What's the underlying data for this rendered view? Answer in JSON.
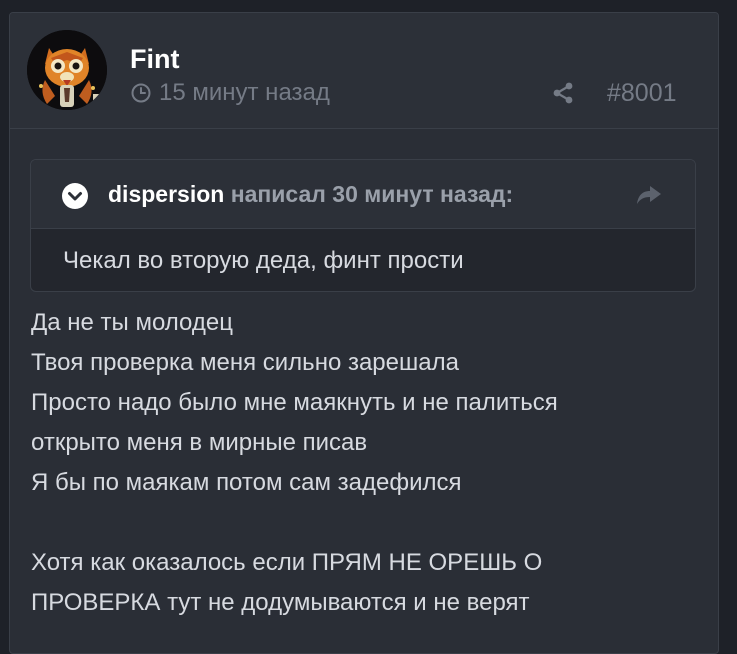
{
  "post": {
    "author": "Fint",
    "time": "15 минут назад",
    "number": "#8001",
    "quote": {
      "author": "dispersion",
      "action": "написал 30 минут назад:",
      "text": "Чекал во вторую деда, финт прости"
    },
    "message_lines": [
      "Да не ты молодец",
      "Твоя проверка меня сильно зарешала",
      "Просто надо было мне маякнуть и не палиться",
      "открыто меня в мирные писав",
      "Я бы по маякам потом сам задефился",
      "",
      "Хотя как оказалось если ПРЯМ НЕ ОРЕШЬ О",
      "ПРОВЕРКА тут не додумываются и не верят"
    ]
  },
  "icons": {
    "time": "clock-icon",
    "share": "share-icon",
    "quote_toggle": "chevron-down-circle-icon",
    "quote_reply": "reply-arrow-icon"
  },
  "colors": {
    "page_bg": "#1e2128",
    "post_bg": "#2a2e36",
    "header_bg": "#2c3038",
    "border": "#3a3f48",
    "text_primary": "#ffffff",
    "text_body": "#d7dae0",
    "text_muted": "#757b86"
  }
}
